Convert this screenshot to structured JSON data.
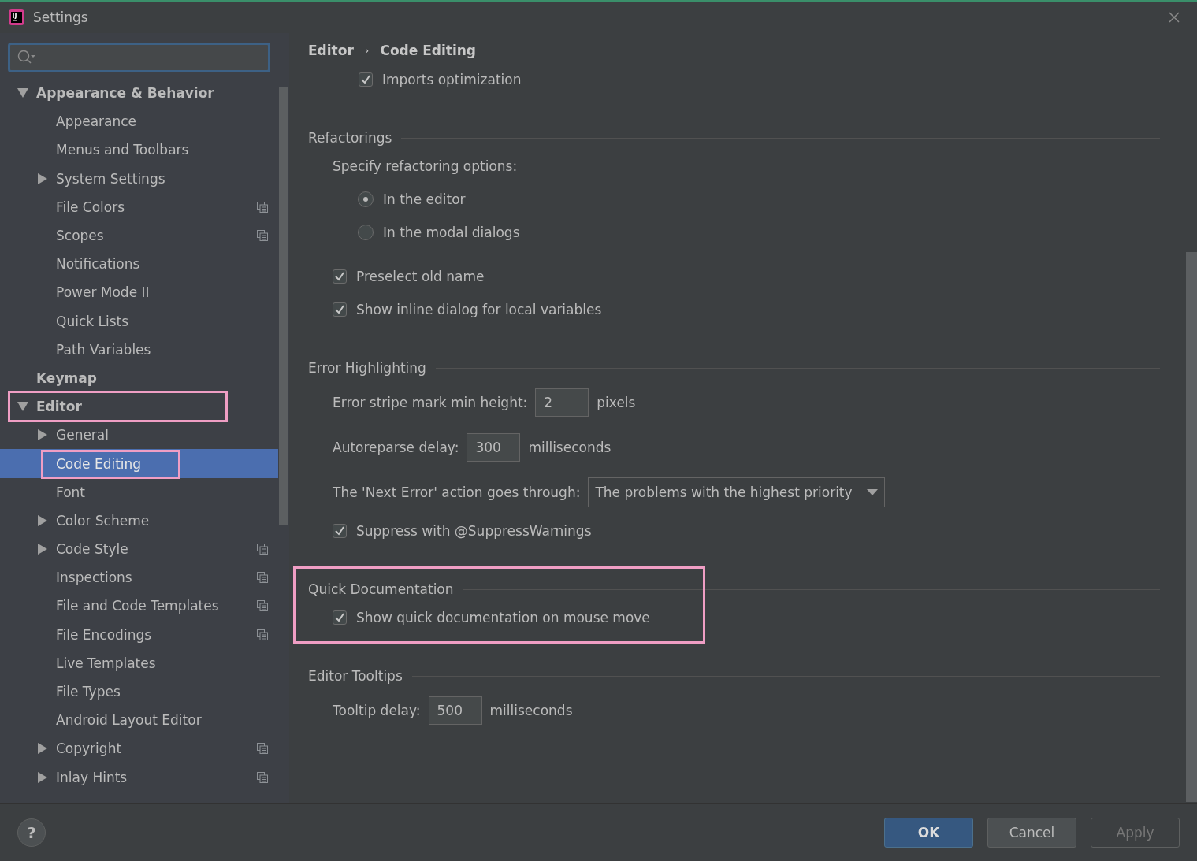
{
  "window": {
    "title": "Settings"
  },
  "sidebar": {
    "items": [
      {
        "label": "Appearance & Behavior",
        "kind": "folder",
        "expanded": true,
        "selected": false,
        "highlighted": false,
        "project_scope": false,
        "children": [
          {
            "label": "Appearance",
            "kind": "leaf",
            "selected": false,
            "highlighted": false,
            "project_scope": false
          },
          {
            "label": "Menus and Toolbars",
            "kind": "leaf",
            "selected": false,
            "highlighted": false,
            "project_scope": false
          },
          {
            "label": "System Settings",
            "kind": "folder",
            "expanded": false,
            "selected": false,
            "highlighted": false,
            "project_scope": false
          },
          {
            "label": "File Colors",
            "kind": "leaf",
            "selected": false,
            "highlighted": false,
            "project_scope": true
          },
          {
            "label": "Scopes",
            "kind": "leaf",
            "selected": false,
            "highlighted": false,
            "project_scope": true
          },
          {
            "label": "Notifications",
            "kind": "leaf",
            "selected": false,
            "highlighted": false,
            "project_scope": false
          },
          {
            "label": "Power Mode II",
            "kind": "leaf",
            "selected": false,
            "highlighted": false,
            "project_scope": false
          },
          {
            "label": "Quick Lists",
            "kind": "leaf",
            "selected": false,
            "highlighted": false,
            "project_scope": false
          },
          {
            "label": "Path Variables",
            "kind": "leaf",
            "selected": false,
            "highlighted": false,
            "project_scope": false
          }
        ]
      },
      {
        "label": "Keymap",
        "kind": "leaf",
        "selected": false,
        "highlighted": false,
        "project_scope": false
      },
      {
        "label": "Editor",
        "kind": "folder",
        "expanded": true,
        "selected": false,
        "highlighted": true,
        "project_scope": false,
        "children": [
          {
            "label": "General",
            "kind": "folder",
            "expanded": false,
            "selected": false,
            "highlighted": false,
            "project_scope": false
          },
          {
            "label": "Code Editing",
            "kind": "leaf",
            "selected": true,
            "highlighted": true,
            "project_scope": false
          },
          {
            "label": "Font",
            "kind": "leaf",
            "selected": false,
            "highlighted": false,
            "project_scope": false
          },
          {
            "label": "Color Scheme",
            "kind": "folder",
            "expanded": false,
            "selected": false,
            "highlighted": false,
            "project_scope": false
          },
          {
            "label": "Code Style",
            "kind": "folder",
            "expanded": false,
            "selected": false,
            "highlighted": false,
            "project_scope": true
          },
          {
            "label": "Inspections",
            "kind": "leaf",
            "selected": false,
            "highlighted": false,
            "project_scope": true
          },
          {
            "label": "File and Code Templates",
            "kind": "leaf",
            "selected": false,
            "highlighted": false,
            "project_scope": true
          },
          {
            "label": "File Encodings",
            "kind": "leaf",
            "selected": false,
            "highlighted": false,
            "project_scope": true
          },
          {
            "label": "Live Templates",
            "kind": "leaf",
            "selected": false,
            "highlighted": false,
            "project_scope": false
          },
          {
            "label": "File Types",
            "kind": "leaf",
            "selected": false,
            "highlighted": false,
            "project_scope": false
          },
          {
            "label": "Android Layout Editor",
            "kind": "leaf",
            "selected": false,
            "highlighted": false,
            "project_scope": false
          },
          {
            "label": "Copyright",
            "kind": "folder",
            "expanded": false,
            "selected": false,
            "highlighted": false,
            "project_scope": true
          },
          {
            "label": "Inlay Hints",
            "kind": "folder",
            "expanded": false,
            "selected": false,
            "highlighted": false,
            "project_scope": true
          }
        ]
      }
    ]
  },
  "breadcrumb": {
    "separator": "›",
    "items": [
      "Editor",
      "Code Editing"
    ]
  },
  "top_rows": [
    {
      "kind": "checkbox",
      "label": "Imports optimization",
      "checked": true
    }
  ],
  "sections": [
    {
      "title": "Refactorings",
      "highlighted": false,
      "rows": [
        {
          "kind": "radio_group",
          "label": "Specify refactoring options:",
          "options": [
            {
              "label": "In the editor",
              "selected": true
            },
            {
              "label": "In the modal dialogs",
              "selected": false
            }
          ]
        },
        {
          "kind": "checkbox",
          "label": "Preselect old name",
          "checked": true
        },
        {
          "kind": "checkbox",
          "label": "Show inline dialog for local variables",
          "checked": true
        }
      ]
    },
    {
      "title": "Error Highlighting",
      "highlighted": false,
      "rows": [
        {
          "kind": "field",
          "label": "Error stripe mark min height:",
          "value": "2",
          "unit": "pixels"
        },
        {
          "kind": "field",
          "label": "Autoreparse delay:",
          "value": "300",
          "unit": "milliseconds"
        },
        {
          "kind": "dropdown",
          "label": "The 'Next Error' action goes through:",
          "value": "The problems with the highest priority"
        },
        {
          "kind": "checkbox",
          "label": "Suppress with @SuppressWarnings",
          "checked": true
        }
      ]
    },
    {
      "title": "Quick Documentation",
      "highlighted": true,
      "rows": [
        {
          "kind": "checkbox",
          "label": "Show quick documentation on mouse move",
          "checked": true
        }
      ]
    },
    {
      "title": "Editor Tooltips",
      "highlighted": false,
      "rows": [
        {
          "kind": "field",
          "label": "Tooltip delay:",
          "value": "500",
          "unit": "milliseconds"
        }
      ]
    }
  ],
  "footer": {
    "help": "?",
    "buttons": [
      {
        "label": "OK",
        "kind": "default",
        "disabled": false
      },
      {
        "label": "Cancel",
        "kind": "normal",
        "disabled": false
      },
      {
        "label": "Apply",
        "kind": "normal",
        "disabled": true
      }
    ]
  }
}
